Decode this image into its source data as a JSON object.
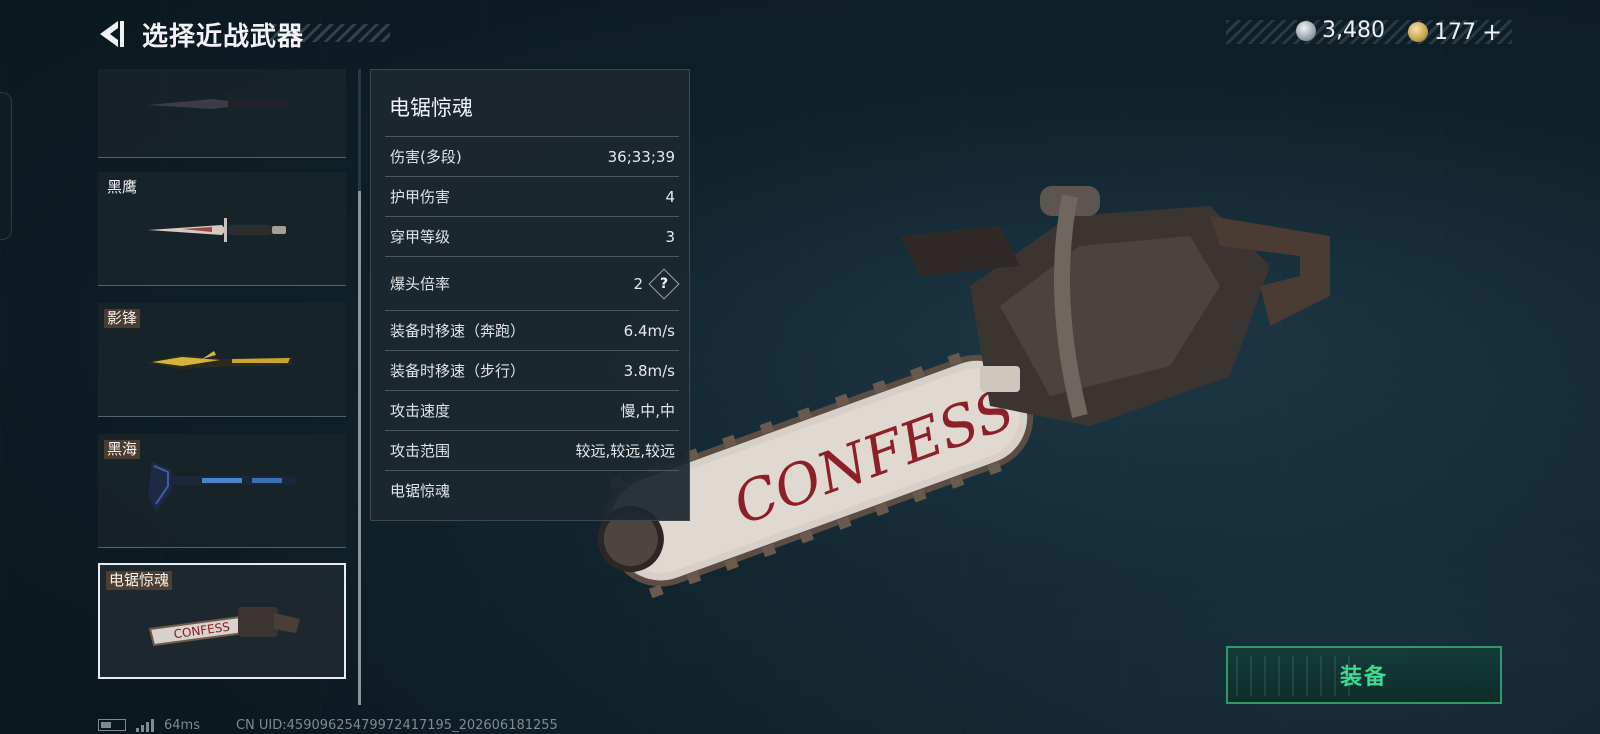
{
  "header": {
    "title": "选择近战武器",
    "currency_silver": "3,480",
    "currency_gold": "177",
    "add_label": "+"
  },
  "weapon_list": {
    "items": [
      {
        "name": "",
        "icon": "combat-knife"
      },
      {
        "name": "黑鹰",
        "icon": "dagger"
      },
      {
        "name": "影锋",
        "icon": "gold-blade"
      },
      {
        "name": "黑海",
        "icon": "tomahawk"
      },
      {
        "name": "电锯惊魂",
        "icon": "chainsaw",
        "selected": true
      }
    ]
  },
  "stats_panel": {
    "title": "电锯惊魂",
    "rows": [
      {
        "label": "伤害(多段)",
        "value": "36;33;39"
      },
      {
        "label": "护甲伤害",
        "value": "4"
      },
      {
        "label": "穿甲等级",
        "value": "3"
      },
      {
        "label": "爆头倍率",
        "value": "2",
        "help": "?"
      },
      {
        "label": "装备时移速（奔跑）",
        "value": "6.4m/s"
      },
      {
        "label": "装备时移速（步行）",
        "value": "3.8m/s"
      },
      {
        "label": "攻击速度",
        "value": "慢,中,中"
      },
      {
        "label": "攻击范围",
        "value": "较远,较远,较远"
      },
      {
        "label": "电锯惊魂",
        "value": ""
      }
    ]
  },
  "preview": {
    "bar_text": "CONFESS"
  },
  "equip_button": {
    "label": "装备"
  },
  "footer": {
    "ping": "64ms",
    "uid": "CN UID:4590962547997241719​5_202606181255"
  },
  "colors": {
    "accent_green": "#3fd98f",
    "panel_bg": "#1c282e",
    "background": "#0f2029"
  }
}
